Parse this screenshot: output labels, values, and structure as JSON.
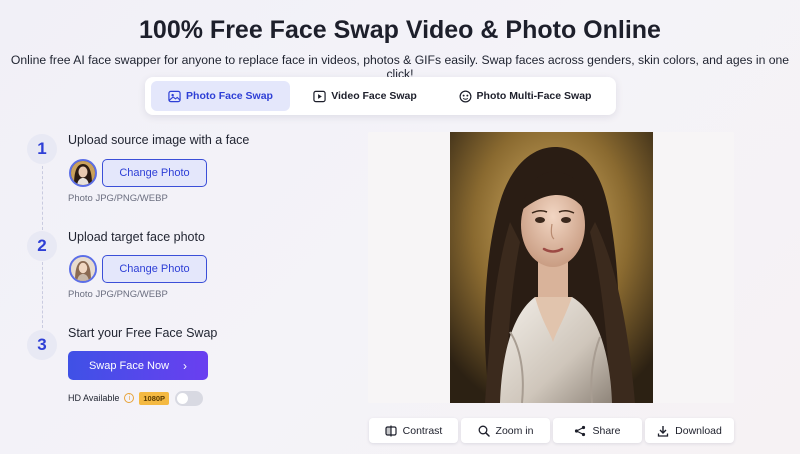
{
  "header": {
    "title": "100% Free Face Swap Video & Photo Online",
    "subtitle": "Online free AI face swapper for anyone to replace face in videos, photos & GIFs easily. Swap faces across genders, skin colors, and ages in one click!"
  },
  "tabs": [
    {
      "label": "Photo Face Swap",
      "icon": "image-icon",
      "active": true
    },
    {
      "label": "Video Face Swap",
      "icon": "video-icon",
      "active": false
    },
    {
      "label": "Photo Multi-Face Swap",
      "icon": "multi-face-icon",
      "active": false
    }
  ],
  "steps": [
    {
      "number": "1",
      "title": "Upload source image with a face",
      "button": "Change Photo",
      "hint": "Photo JPG/PNG/WEBP"
    },
    {
      "number": "2",
      "title": "Upload target face photo",
      "button": "Change Photo",
      "hint": "Photo JPG/PNG/WEBP"
    },
    {
      "number": "3",
      "title": "Start your Free Face Swap"
    }
  ],
  "swap_button": "Swap Face Now",
  "hd": {
    "label": "HD Available",
    "badge": "1080P",
    "enabled": false
  },
  "actions": [
    {
      "label": "Contrast",
      "icon": "contrast-icon"
    },
    {
      "label": "Zoom in",
      "icon": "zoom-icon"
    },
    {
      "label": "Share",
      "icon": "share-icon"
    },
    {
      "label": "Download",
      "icon": "download-icon"
    }
  ],
  "colors": {
    "accent": "#2e3fd6",
    "accent_light": "#e4e7fb",
    "gradient_start": "#3f51e6",
    "gradient_end": "#6a3ff0",
    "badge": "#f4b942"
  }
}
